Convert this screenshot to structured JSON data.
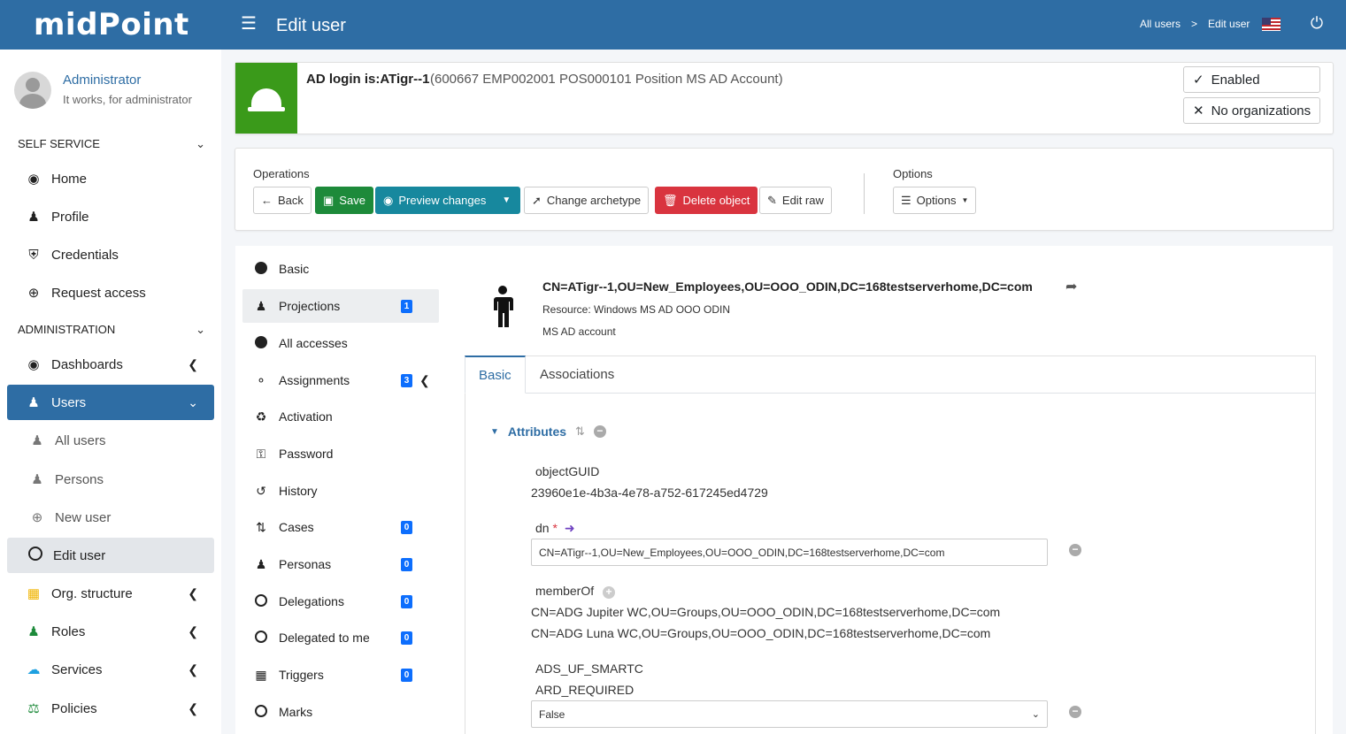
{
  "header": {
    "logo": "midPoint",
    "title": "Edit user",
    "breadcrumb": [
      "All users",
      ">",
      "Edit user"
    ]
  },
  "user": {
    "name": "Administrator",
    "message": "It works, for administrator"
  },
  "sidebar": {
    "self_service_label": "SELF SERVICE",
    "administration_label": "ADMINISTRATION",
    "self_items": [
      {
        "label": "Home",
        "icon": "dashboard-icon"
      },
      {
        "label": "Profile",
        "icon": "user-icon"
      },
      {
        "label": "Credentials",
        "icon": "shield-icon"
      },
      {
        "label": "Request access",
        "icon": "plus-circle-icon"
      }
    ],
    "admin_items": [
      {
        "label": "Dashboards"
      },
      {
        "label": "Users"
      },
      {
        "label": "All users"
      },
      {
        "label": "Persons"
      },
      {
        "label": "New user"
      },
      {
        "label": "Edit user"
      },
      {
        "label": "Org. structure"
      },
      {
        "label": "Roles"
      },
      {
        "label": "Services"
      },
      {
        "label": "Policies"
      }
    ]
  },
  "object": {
    "title": "AD login is:ATigr--1",
    "description": "(600667 EMP002001 POS000101 Position MS AD Account)",
    "enabled_label": "Enabled",
    "org_label": "No organizations"
  },
  "operations": {
    "label": "Operations",
    "back": "Back",
    "save": "Save",
    "preview": "Preview changes",
    "change_archetype": "Change archetype",
    "delete": "Delete object",
    "edit_raw": "Edit raw",
    "options_label": "Options",
    "options_button": "Options"
  },
  "menu": [
    {
      "label": "Basic"
    },
    {
      "label": "Projections",
      "badge": "1"
    },
    {
      "label": "All accesses"
    },
    {
      "label": "Assignments",
      "badge": "3"
    },
    {
      "label": "Activation"
    },
    {
      "label": "Password"
    },
    {
      "label": "History"
    },
    {
      "label": "Cases",
      "badge": "0"
    },
    {
      "label": "Personas",
      "badge": "0"
    },
    {
      "label": "Delegations",
      "badge": "0"
    },
    {
      "label": "Delegated to me",
      "badge": "0"
    },
    {
      "label": "Triggers",
      "badge": "0"
    },
    {
      "label": "Marks"
    }
  ],
  "projection": {
    "dn_title": "CN=ATigr--1,OU=New_Employees,OU=OOO_ODIN,DC=168testserverhome,DC=com",
    "resource": "Resource: Windows MS AD OOO ODIN",
    "kind": "MS AD account",
    "tabs": [
      "Basic",
      "Associations"
    ],
    "attributes_label": "Attributes",
    "fields": {
      "objectguid_label": "objectGUID",
      "objectguid_value": "23960e1e-4b3a-4e78-a752-617245ed4729",
      "dn_label": "dn",
      "dn_required": "*",
      "dn_value": "CN=ATigr--1,OU=New_Employees,OU=OOO_ODIN,DC=168testserverhome,DC=com",
      "memberof_label": "memberOf",
      "memberof_values": [
        "CN=ADG Jupiter WC,OU=Groups,OU=OOO_ODIN,DC=168testserverhome,DC=com",
        "CN=ADG Luna WC,OU=Groups,OU=OOO_ODIN,DC=168testserverhome,DC=com"
      ],
      "smartcard_label_1": "ADS_UF_SMARTC",
      "smartcard_label_2": "ARD_REQUIRED",
      "smartcard_value": "False"
    }
  },
  "colors": {
    "topbar": "#2e6da4",
    "green": "#1d8a3a",
    "teal": "#17889e",
    "red": "#d9343f",
    "badge": "#0d6efd"
  }
}
